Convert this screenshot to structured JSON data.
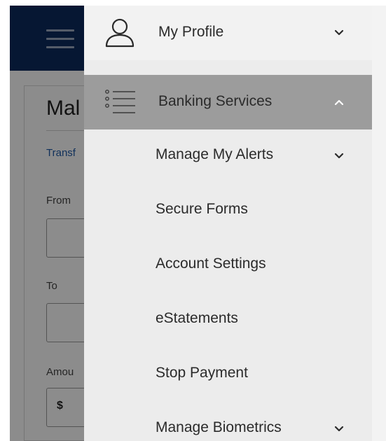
{
  "background": {
    "title_partial": "Mal",
    "link_partial": "Transf",
    "from_label": "From",
    "to_label": "To",
    "amount_label": "Amou",
    "currency_symbol": "$"
  },
  "menu": {
    "top_items": [
      {
        "label": "My Profile",
        "icon": "user-icon",
        "chevron": "chevron-down",
        "expanded": false
      },
      {
        "label": "Banking Services",
        "icon": "list-icon",
        "chevron": "chevron-up",
        "expanded": true
      }
    ],
    "sub_items": [
      {
        "label": "Manage My Alerts",
        "has_chevron": true
      },
      {
        "label": "Secure Forms",
        "has_chevron": false
      },
      {
        "label": "Account Settings",
        "has_chevron": false
      },
      {
        "label": "eStatements",
        "has_chevron": false
      },
      {
        "label": "Stop Payment",
        "has_chevron": false
      },
      {
        "label": "Manage Biometrics",
        "has_chevron": true
      }
    ]
  },
  "colors": {
    "header": "#0c2b5e",
    "drawer_bg": "#ececec",
    "active_row": "#9c9c9c",
    "text": "#2b2b2b",
    "link": "#1f5aa6"
  }
}
